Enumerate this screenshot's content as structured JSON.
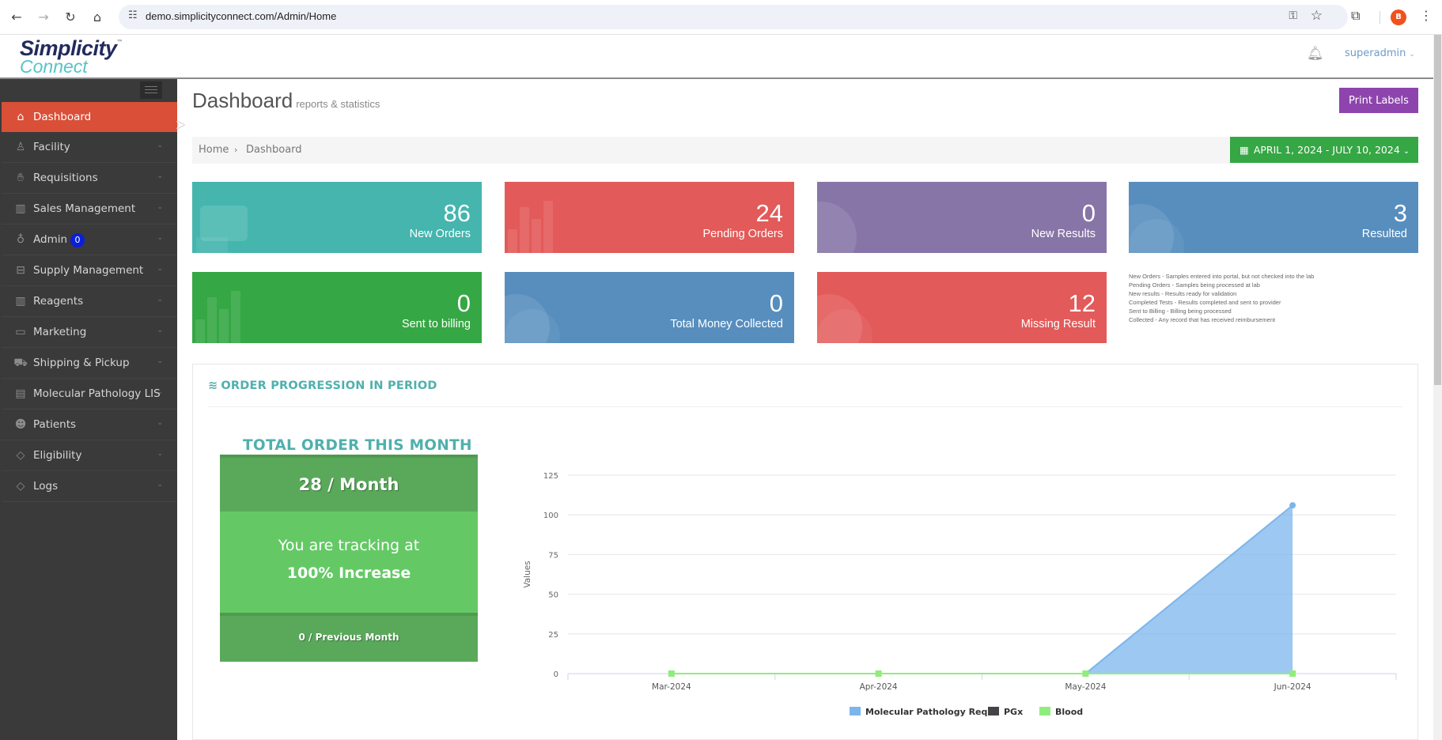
{
  "browser": {
    "url": "demo.simplicityconnect.com/Admin/Home",
    "profile_initial": "B"
  },
  "header": {
    "logo_line1": "Simplicity",
    "logo_tm": "™",
    "logo_line2": "Connect",
    "user": "superadmin"
  },
  "sidebar": {
    "items": [
      {
        "label": "Dashboard",
        "icon": "home-icon",
        "active": true
      },
      {
        "label": "Facility",
        "icon": "user-tie-icon"
      },
      {
        "label": "Requisitions",
        "icon": "hand-icon"
      },
      {
        "label": "Sales Management",
        "icon": "bar-chart-icon"
      },
      {
        "label": "Admin",
        "icon": "lightbulb-icon",
        "badge": "0"
      },
      {
        "label": "Supply Management",
        "icon": "briefcase-icon"
      },
      {
        "label": "Reagents",
        "icon": "bar-chart-icon"
      },
      {
        "label": "Marketing",
        "icon": "wallet-icon"
      },
      {
        "label": "Shipping & Pickup",
        "icon": "truck-icon"
      },
      {
        "label": "Molecular Pathology LIS",
        "icon": "file-icon"
      },
      {
        "label": "Patients",
        "icon": "users-icon"
      },
      {
        "label": "Eligibility",
        "icon": "diamond-icon"
      },
      {
        "label": "Logs",
        "icon": "diamond-icon"
      }
    ]
  },
  "page": {
    "title": "Dashboard",
    "subtitle": "reports & statistics",
    "print_labels": "Print Labels",
    "breadcrumb": [
      "Home",
      "Dashboard"
    ],
    "breadcrumb_sep": "›",
    "date_range": "APRIL 1, 2024 - JULY 10, 2024"
  },
  "stats": [
    {
      "value": "86",
      "label": "New Orders",
      "color": "#45b5ae"
    },
    {
      "value": "24",
      "label": "Pending Orders",
      "color": "#e25a59"
    },
    {
      "value": "0",
      "label": "New Results",
      "color": "#8775a7"
    },
    {
      "value": "3",
      "label": "Resulted",
      "color": "#578ebe"
    },
    {
      "value": "0",
      "label": "Sent to billing",
      "color": "#35a744"
    },
    {
      "value": "0",
      "label": "Total Money Collected",
      "color": "#578ebe"
    },
    {
      "value": "12",
      "label": "Missing Result",
      "color": "#e25a59"
    }
  ],
  "notes": [
    "New Orders - Samples entered into portal, but not checked into the lab",
    "Pending Orders - Samples being processed at lab",
    "New results - Results ready for validation",
    "Completed Tests - Results completed and sent to provider",
    "Sent to Billing - Billing being processed",
    "Collected - Any record that has received reimbursement"
  ],
  "panel": {
    "title": "ORDER PROGRESSION IN PERIOD",
    "total_title": "TOTAL ORDER THIS MONTH",
    "per_month": "28 / Month",
    "tracking_line1": "You are tracking at",
    "tracking_line2": "100% Increase",
    "previous": "0 / Previous Month"
  },
  "chart_data": {
    "type": "area",
    "title": "",
    "xlabel": "",
    "ylabel": "Values",
    "categories": [
      "Mar-2024",
      "Apr-2024",
      "May-2024",
      "Jun-2024"
    ],
    "ylim": [
      0,
      125
    ],
    "yticks": [
      0,
      25,
      50,
      75,
      100,
      125
    ],
    "grid": true,
    "legend_position": "bottom",
    "series": [
      {
        "name": "Molecular Pathology Req",
        "color": "#7cb5ec",
        "values": [
          0,
          0,
          0,
          106
        ]
      },
      {
        "name": "PGx",
        "color": "#434348",
        "values": [
          0,
          0,
          0,
          0
        ]
      },
      {
        "name": "Blood",
        "color": "#90ed7d",
        "values": [
          0,
          0,
          0,
          0
        ]
      }
    ]
  }
}
